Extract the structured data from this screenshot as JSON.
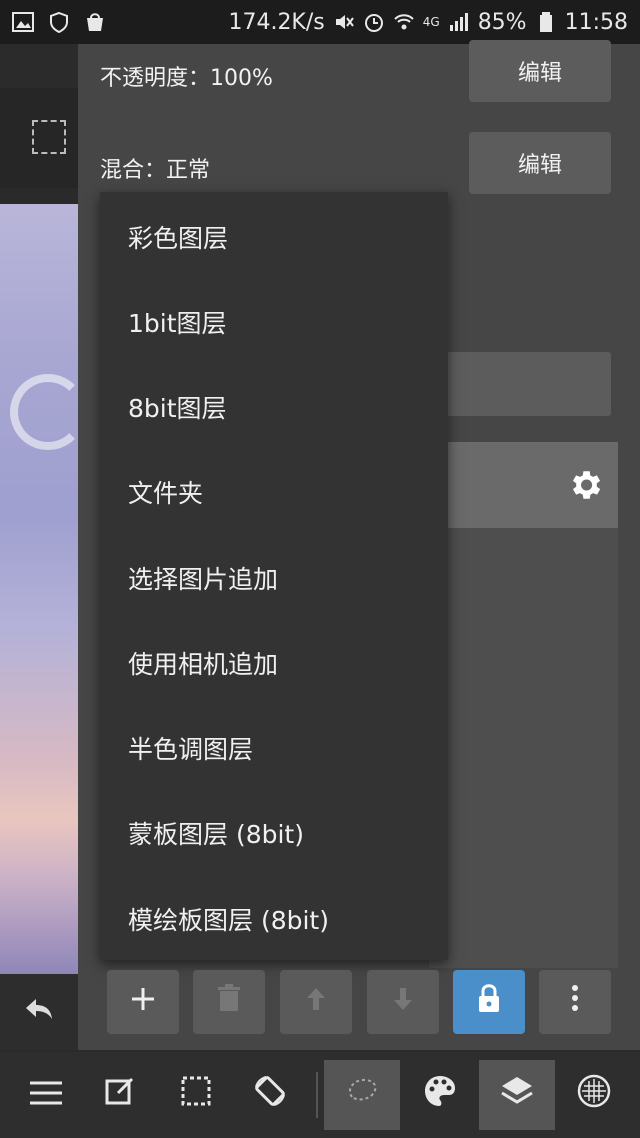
{
  "status_bar": {
    "network_speed": "174.2K/s",
    "signal": "4G",
    "battery": "85%",
    "time": "11:58",
    "left_icons": [
      "gallery-icon",
      "shield-icon",
      "bag-icon"
    ]
  },
  "layer_properties": {
    "opacity_label": "不透明度：100%",
    "blend_label": "混合：正常",
    "opacity_edit": "编辑",
    "blend_edit": "编辑"
  },
  "add_layer_menu": {
    "items": [
      "彩色图层",
      "1bit图层",
      "8bit图层",
      "文件夹",
      "选择图片追加",
      "使用相机追加",
      "半色调图层",
      "蒙板图层 (8bit)",
      "模绘板图层 (8bit)"
    ]
  },
  "layer_actions": [
    "add-icon",
    "trash-icon",
    "arrow-up-icon",
    "arrow-down-icon",
    "lock-icon",
    "more-vertical-icon"
  ],
  "bottom_toolbar": [
    "menu-icon",
    "edit-icon",
    "selection-icon",
    "rotate-screen-icon",
    "lasso-icon",
    "palette-icon",
    "layers-icon",
    "grid-icon"
  ],
  "colors": {
    "accent": "#4a8fc9",
    "panel": "#464646",
    "menu": "#333333"
  }
}
